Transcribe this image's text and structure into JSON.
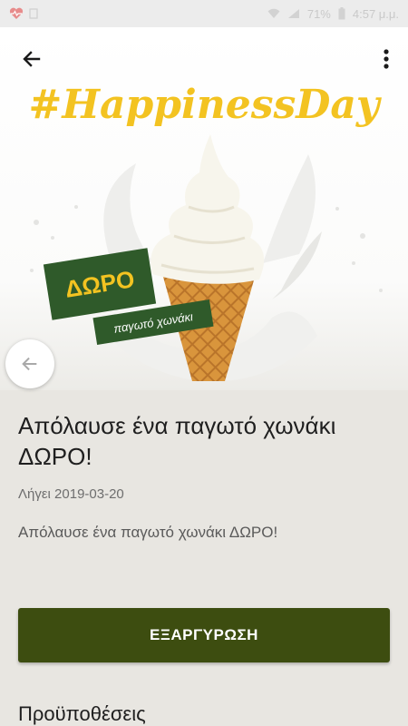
{
  "status_bar": {
    "battery": "71%",
    "time": "4:57 μ.μ."
  },
  "hero": {
    "hashtag": "#HappinessDay",
    "badge": "ΔΩΡΟ",
    "badge_sub": "παγωτό χωνάκι"
  },
  "offer": {
    "title": "Απόλαυσε ένα παγωτό χωνάκι ΔΩΡΟ!",
    "expires": "Λήγει 2019-03-20",
    "description": "Απόλαυσε ένα παγωτό χωνάκι ΔΩΡΟ!"
  },
  "actions": {
    "redeem_label": "ΕΞΑΡΓΥΡΩΣΗ"
  },
  "terms_heading": "Προϋποθέσεις",
  "colors": {
    "accent_green": "#3d4d10",
    "badge_green": "#2f5a2a",
    "hashtag_yellow": "#f3c321"
  },
  "icons": {
    "back": "arrow-left-icon",
    "more": "more-vert-icon",
    "prev": "arrow-left-icon"
  }
}
